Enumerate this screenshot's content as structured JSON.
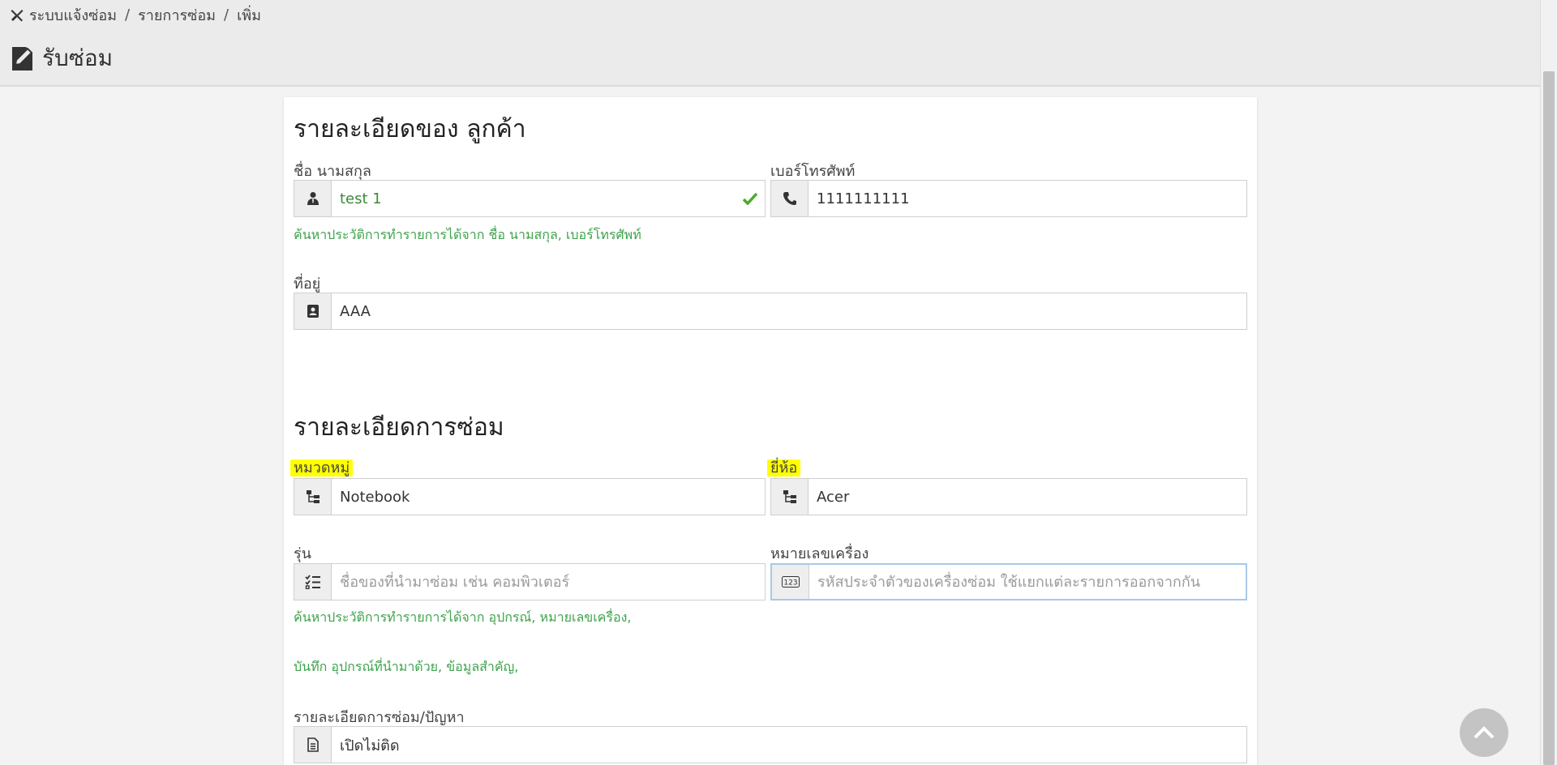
{
  "breadcrumb": {
    "items": [
      "ระบบแจ้งซ่อม",
      "รายการซ่อม",
      "เพิ่ม"
    ],
    "separator": "/"
  },
  "page": {
    "title": "รับซ่อม"
  },
  "customer_section": {
    "heading": "รายละเอียดของ ลูกค้า",
    "name": {
      "label": "ชื่อ นามสกุล",
      "value": "test 1",
      "icon": "user-tie-icon"
    },
    "phone": {
      "label": "เบอร์โทรศัพท์",
      "value": "1111111111",
      "icon": "phone-icon"
    },
    "search_hint": "ค้นหาประวัติการทำรายการได้จาก ชื่อ นามสกุล, เบอร์โทรศัพท์",
    "address": {
      "label": "ที่อยู่",
      "value": "AAA",
      "icon": "address-card-icon"
    }
  },
  "repair_section": {
    "heading": "รายละเอียดการซ่อม",
    "category": {
      "label": "หมวดหมู่",
      "value": "Notebook",
      "icon": "sitemap-icon"
    },
    "brand": {
      "label": "ยี่ห้อ",
      "value": "Acer",
      "icon": "sitemap-icon"
    },
    "model": {
      "label": "รุ่น",
      "value": "",
      "placeholder": "ชื่อของที่นำมาซ่อม เช่น คอมพิวเตอร์",
      "icon": "tasks-icon"
    },
    "serial": {
      "label": "หมายเลขเครื่อง",
      "value": "",
      "placeholder": "รหัสประจำตัวของเครื่องซ่อม ใช้แยกแต่ละรายการออกจากกัน",
      "icon": "numbers-123-icon"
    },
    "search_hint": "ค้นหาประวัติการทำรายการได้จาก อุปกรณ์, หมายเลขเครื่อง,",
    "save_hint": "บันทึก อุปกรณ์ที่นำมาด้วย, ข้อมูลสำคัญ,",
    "problem": {
      "label": "รายละเอียดการซ่อม/ปัญหา",
      "value": "เปิดไม่ติด",
      "icon": "file-text-icon"
    }
  },
  "colors": {
    "accent_green": "#3fa34d",
    "highlight": "#ffff00",
    "focus_border": "#a9c8e8"
  }
}
